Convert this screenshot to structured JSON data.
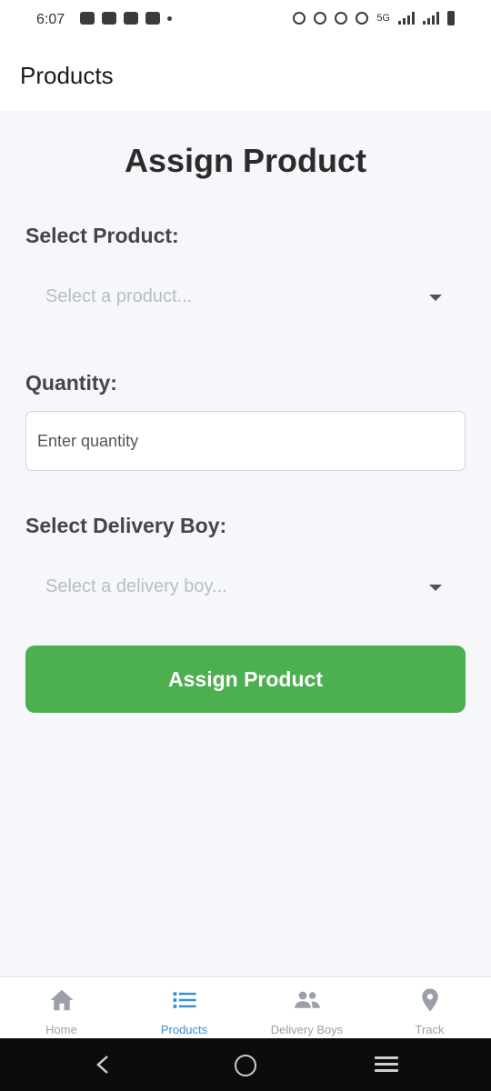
{
  "status_bar": {
    "time": "6:07",
    "left_icons": [
      "chat-icon",
      "wifi-calling-icon",
      "youtube-icon",
      "teams-icon",
      "dot-icon"
    ],
    "right_icons": [
      "alarm-icon",
      "bluetooth-icon",
      "volte-icon",
      "hotspot-icon",
      "signal-icon",
      "signal-icon",
      "battery-icon"
    ],
    "network": "5G"
  },
  "header": {
    "title": "Products"
  },
  "form": {
    "heading": "Assign Product",
    "product_label": "Select Product:",
    "product_placeholder": "Select a product...",
    "quantity_label": "Quantity:",
    "quantity_placeholder": "Enter quantity",
    "delivery_label": "Select Delivery Boy:",
    "delivery_placeholder": "Select a delivery boy...",
    "submit_label": "Assign Product"
  },
  "bottom_nav": {
    "items": [
      {
        "label": "Home",
        "icon": "home-icon",
        "active": false
      },
      {
        "label": "Products",
        "icon": "list-icon",
        "active": true
      },
      {
        "label": "Delivery Boys",
        "icon": "people-icon",
        "active": false
      },
      {
        "label": "Track",
        "icon": "location-pin-icon",
        "active": false
      }
    ]
  },
  "colors": {
    "accent": "#4caf50",
    "active_tab": "#3a8fd8",
    "inactive_tab": "#9aa0a6",
    "background": "#f5f7fa"
  }
}
